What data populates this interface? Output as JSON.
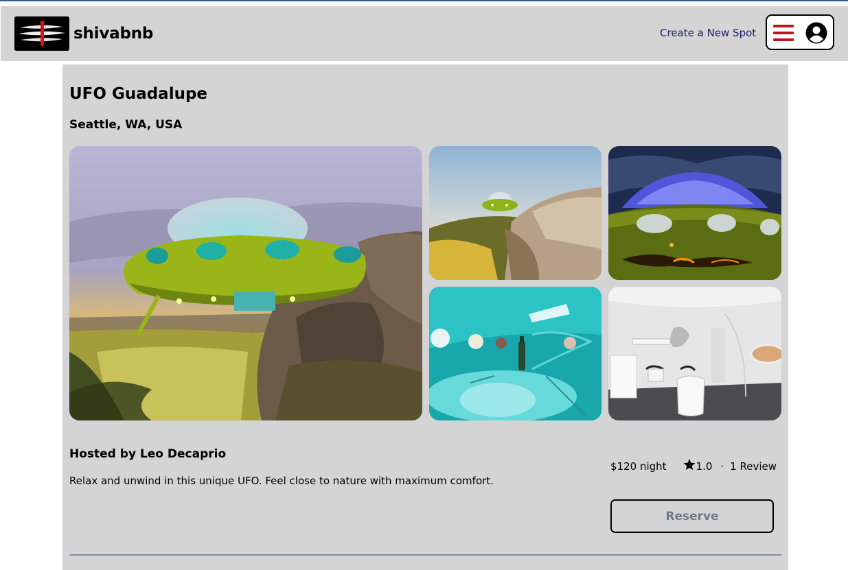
{
  "header": {
    "brand": "shivabnb",
    "create_link": "Create a New Spot",
    "menu_icon": "hamburger-icon",
    "user_icon": "user-circle-icon",
    "accent_color": "#c0151f",
    "link_color": "#1d1f6e"
  },
  "spot": {
    "name": "UFO Guadalupe",
    "location": "Seattle, WA, USA",
    "images": [
      "ufo-exterior-sunset",
      "ufo-on-hillside",
      "ufo-dome-night",
      "ufo-teal-interior",
      "ufo-bathroom"
    ],
    "host": "Hosted by Leo Decaprio",
    "description": "Relax and unwind in this unique UFO. Feel close to nature with maximum comfort."
  },
  "booking": {
    "price": "$120 night",
    "rating": "1.0",
    "separator": "·",
    "reviews": "1 Review",
    "reserve_label": "Reserve",
    "star_icon": "star-icon"
  }
}
